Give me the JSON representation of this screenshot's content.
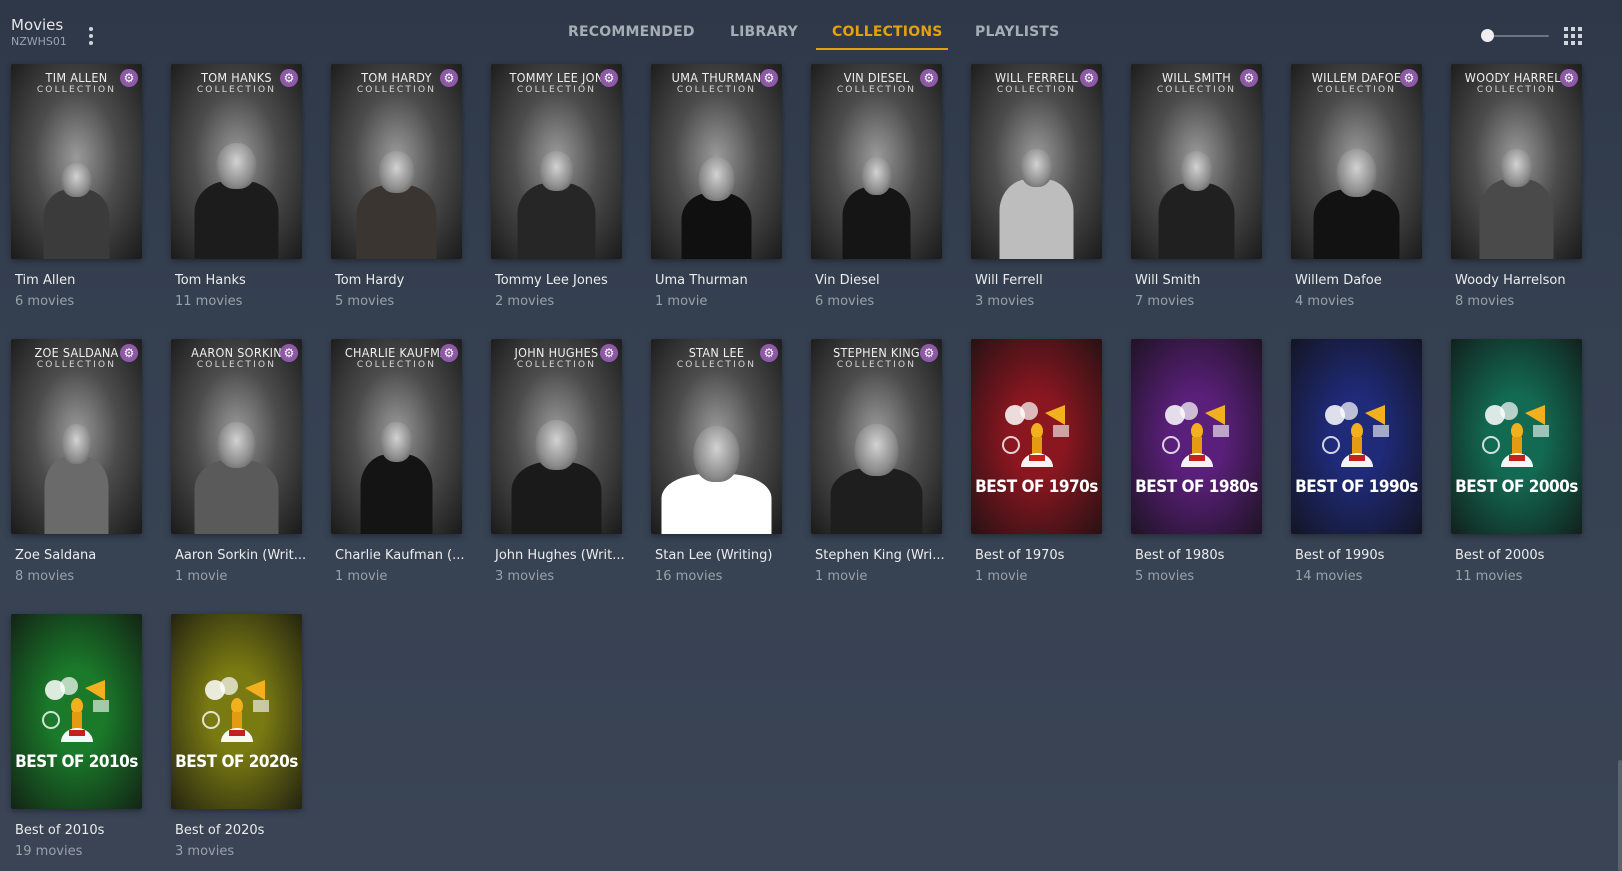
{
  "library": {
    "name": "Movies",
    "server": "NZWHS01"
  },
  "tabs": [
    {
      "label": "RECOMMENDED",
      "active": false
    },
    {
      "label": "LIBRARY",
      "active": false
    },
    {
      "label": "COLLECTIONS",
      "active": true
    },
    {
      "label": "PLAYLISTS",
      "active": false
    }
  ],
  "colors": {
    "accent": "#e5a00d",
    "badge": "#8e5aa8",
    "background": "#323c4b"
  },
  "collections": [
    {
      "poster_title": "TIM ALLEN",
      "poster_sub": "COLLECTION",
      "title": "Tim Allen",
      "count": "6 movies",
      "kind": "person"
    },
    {
      "poster_title": "TOM HANKS",
      "poster_sub": "COLLECTION",
      "title": "Tom Hanks",
      "count": "11 movies",
      "kind": "person"
    },
    {
      "poster_title": "TOM HARDY",
      "poster_sub": "COLLECTION",
      "title": "Tom Hardy",
      "count": "5 movies",
      "kind": "person"
    },
    {
      "poster_title": "TOMMY LEE JON",
      "poster_sub": "COLLECTION",
      "title": "Tommy Lee Jones",
      "count": "2 movies",
      "kind": "person"
    },
    {
      "poster_title": "UMA THURMAN",
      "poster_sub": "COLLECTION",
      "title": "Uma Thurman",
      "count": "1 movie",
      "kind": "person"
    },
    {
      "poster_title": "VIN DIESEL",
      "poster_sub": "COLLECTION",
      "title": "Vin Diesel",
      "count": "6 movies",
      "kind": "person"
    },
    {
      "poster_title": "WILL FERRELL",
      "poster_sub": "COLLECTION",
      "title": "Will Ferrell",
      "count": "3 movies",
      "kind": "person"
    },
    {
      "poster_title": "WILL SMITH",
      "poster_sub": "COLLECTION",
      "title": "Will Smith",
      "count": "7 movies",
      "kind": "person"
    },
    {
      "poster_title": "WILLEM DAFOE",
      "poster_sub": "COLLECTION",
      "title": "Willem Dafoe",
      "count": "4 movies",
      "kind": "person"
    },
    {
      "poster_title": "WOODY HARRELS",
      "poster_sub": "COLLECTION",
      "title": "Woody Harrelson",
      "count": "8 movies",
      "kind": "person"
    },
    {
      "poster_title": "ZOE SALDANA",
      "poster_sub": "COLLECTION",
      "title": "Zoe Saldana",
      "count": "8 movies",
      "kind": "person"
    },
    {
      "poster_title": "AARON SORKIN",
      "poster_sub": "COLLECTION",
      "title": "Aaron Sorkin (Writ...",
      "count": "1 movie",
      "kind": "person"
    },
    {
      "poster_title": "CHARLIE KAUFMA",
      "poster_sub": "COLLECTION",
      "title": "Charlie Kaufman (...",
      "count": "1 movie",
      "kind": "person"
    },
    {
      "poster_title": "JOHN HUGHES",
      "poster_sub": "COLLECTION",
      "title": "John Hughes (Writ...",
      "count": "3 movies",
      "kind": "person"
    },
    {
      "poster_title": "STAN LEE",
      "poster_sub": "COLLECTION",
      "title": "Stan Lee (Writing)",
      "count": "16 movies",
      "kind": "person"
    },
    {
      "poster_title": "STEPHEN KING",
      "poster_sub": "COLLECTION",
      "title": "Stephen King (Wri...",
      "count": "1 movie",
      "kind": "person"
    },
    {
      "poster_title": "BEST OF 1970s",
      "title": "Best of 1970s",
      "count": "1 movie",
      "kind": "best",
      "color": "#8a1620"
    },
    {
      "poster_title": "BEST OF 1980s",
      "title": "Best of 1980s",
      "count": "5 movies",
      "kind": "best",
      "color": "#5a1f7a"
    },
    {
      "poster_title": "BEST OF 1990s",
      "title": "Best of 1990s",
      "count": "14 movies",
      "kind": "best",
      "color": "#1f2a78"
    },
    {
      "poster_title": "BEST OF 2000s",
      "title": "Best of 2000s",
      "count": "11 movies",
      "kind": "best",
      "color": "#136a52"
    },
    {
      "poster_title": "BEST OF 2010s",
      "title": "Best of 2010s",
      "count": "19 movies",
      "kind": "best",
      "color": "#1a7a2a"
    },
    {
      "poster_title": "BEST OF 2020s",
      "title": "Best of 2020s",
      "count": "3 movies",
      "kind": "best",
      "color": "#7a7a12"
    }
  ]
}
